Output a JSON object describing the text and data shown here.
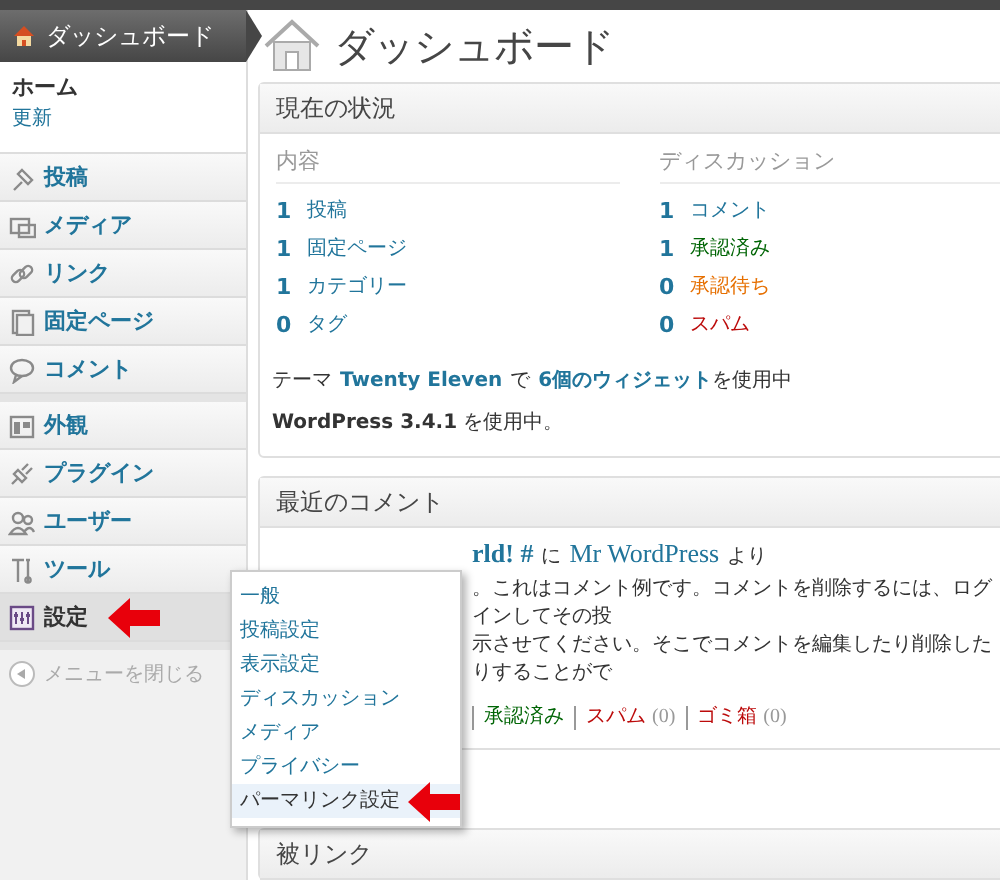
{
  "sidebar": {
    "header": {
      "label": "ダッシュボード",
      "selected": true
    },
    "submenu": [
      {
        "label": "ホーム",
        "selected": true
      },
      {
        "label": "更新",
        "selected": false
      }
    ],
    "groups": [
      [
        {
          "label": "投稿",
          "selected": false,
          "marked": false
        },
        {
          "label": "メディア",
          "selected": false,
          "marked": false
        },
        {
          "label": "リンク",
          "selected": false,
          "marked": false
        },
        {
          "label": "固定ページ",
          "selected": false,
          "marked": false
        },
        {
          "label": "コメント",
          "selected": false,
          "marked": false
        }
      ],
      [
        {
          "label": "外観",
          "selected": false,
          "marked": false
        },
        {
          "label": "プラグイン",
          "selected": false,
          "marked": false
        },
        {
          "label": "ユーザー",
          "selected": false,
          "marked": false
        },
        {
          "label": "ツール",
          "selected": false,
          "marked": false
        },
        {
          "label": "設定",
          "selected": true,
          "marked": true
        }
      ]
    ],
    "collapse": "メニューを閉じる",
    "flyout": [
      {
        "label": "一般",
        "selected": false,
        "marked": false
      },
      {
        "label": "投稿設定",
        "selected": false,
        "marked": false
      },
      {
        "label": "表示設定",
        "selected": false,
        "marked": false
      },
      {
        "label": "ディスカッション",
        "selected": false,
        "marked": false
      },
      {
        "label": "メディア",
        "selected": false,
        "marked": false
      },
      {
        "label": "プライバシー",
        "selected": false,
        "marked": false
      },
      {
        "label": "パーマリンク設定",
        "selected": true,
        "marked": true
      }
    ]
  },
  "page_title": "ダッシュボード",
  "right_now": {
    "title": "現在の状況",
    "columns": [
      {
        "heading": "内容",
        "rows": [
          {
            "count": "1",
            "label": "投稿",
            "color": "#21759b"
          },
          {
            "count": "1",
            "label": "固定ページ",
            "color": "#21759b"
          },
          {
            "count": "1",
            "label": "カテゴリー",
            "color": "#21759b"
          },
          {
            "count": "0",
            "label": "タグ",
            "color": "#21759b"
          }
        ]
      },
      {
        "heading": "ディスカッション",
        "rows": [
          {
            "count": "1",
            "label": "コメント",
            "color": "#21759b"
          },
          {
            "count": "1",
            "label": "承認済み",
            "color": "#006505"
          },
          {
            "count": "0",
            "label": "承認待ち",
            "color": "#e66f00"
          },
          {
            "count": "0",
            "label": "スパム",
            "color": "#bc0b0b"
          }
        ]
      }
    ],
    "theme_line": {
      "before": "テーマ",
      "theme": "Twenty Eleven",
      "middle": "で",
      "widgets": "6個のウィジェット",
      "after": "を使用中"
    },
    "version_line": "**WordPress 3.4.1** を使用中。"
  },
  "recent_comments": {
    "title": "最近のコメント",
    "post": "rld! #",
    "on": "に",
    "author": "Mr WordPress",
    "by": "より",
    "excerpt": [
      "。これはコメント例です。コメントを削除するには、ログインしてその投",
      "示させてください。そこでコメントを編集したり削除したりすることがで"
    ],
    "links": [
      {
        "label": "承認済み",
        "color": "#006505"
      },
      {
        "label": "スパム",
        "count": "(0)",
        "color": "#bc0b0b"
      },
      {
        "label": "ゴミ箱",
        "count": "(0)",
        "color": "#bc0b0b"
      }
    ]
  },
  "incoming_links": {
    "title": "被リンク"
  }
}
